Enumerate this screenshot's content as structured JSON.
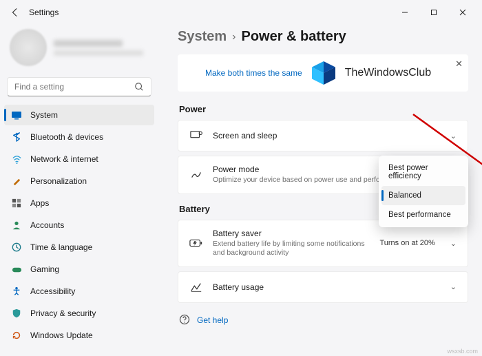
{
  "window": {
    "title": "Settings",
    "minimize": "Minimize",
    "maximize": "Maximize",
    "close": "Close"
  },
  "search": {
    "placeholder": "Find a setting"
  },
  "sidebar": {
    "items": [
      {
        "label": "System"
      },
      {
        "label": "Bluetooth & devices"
      },
      {
        "label": "Network & internet"
      },
      {
        "label": "Personalization"
      },
      {
        "label": "Apps"
      },
      {
        "label": "Accounts"
      },
      {
        "label": "Time & language"
      },
      {
        "label": "Gaming"
      },
      {
        "label": "Accessibility"
      },
      {
        "label": "Privacy & security"
      },
      {
        "label": "Windows Update"
      }
    ]
  },
  "breadcrumb": {
    "parent": "System",
    "sep": "›",
    "current": "Power & battery"
  },
  "banner": {
    "link": "Make both times the same",
    "brand": "TheWindowsClub"
  },
  "sections": {
    "power": {
      "title": "Power",
      "screen_sleep": {
        "title": "Screen and sleep"
      },
      "power_mode": {
        "title": "Power mode",
        "sub": "Optimize your device based on power use and performance"
      }
    },
    "battery": {
      "title": "Battery",
      "saver": {
        "title": "Battery saver",
        "sub": "Extend battery life by limiting some notifications and background activity",
        "status": "Turns on at 20%"
      },
      "usage": {
        "title": "Battery usage"
      }
    }
  },
  "popup": {
    "options": [
      "Best power efficiency",
      "Balanced",
      "Best performance"
    ],
    "selected": "Balanced"
  },
  "help": {
    "label": "Get help"
  },
  "watermark": "wsxsb.com"
}
